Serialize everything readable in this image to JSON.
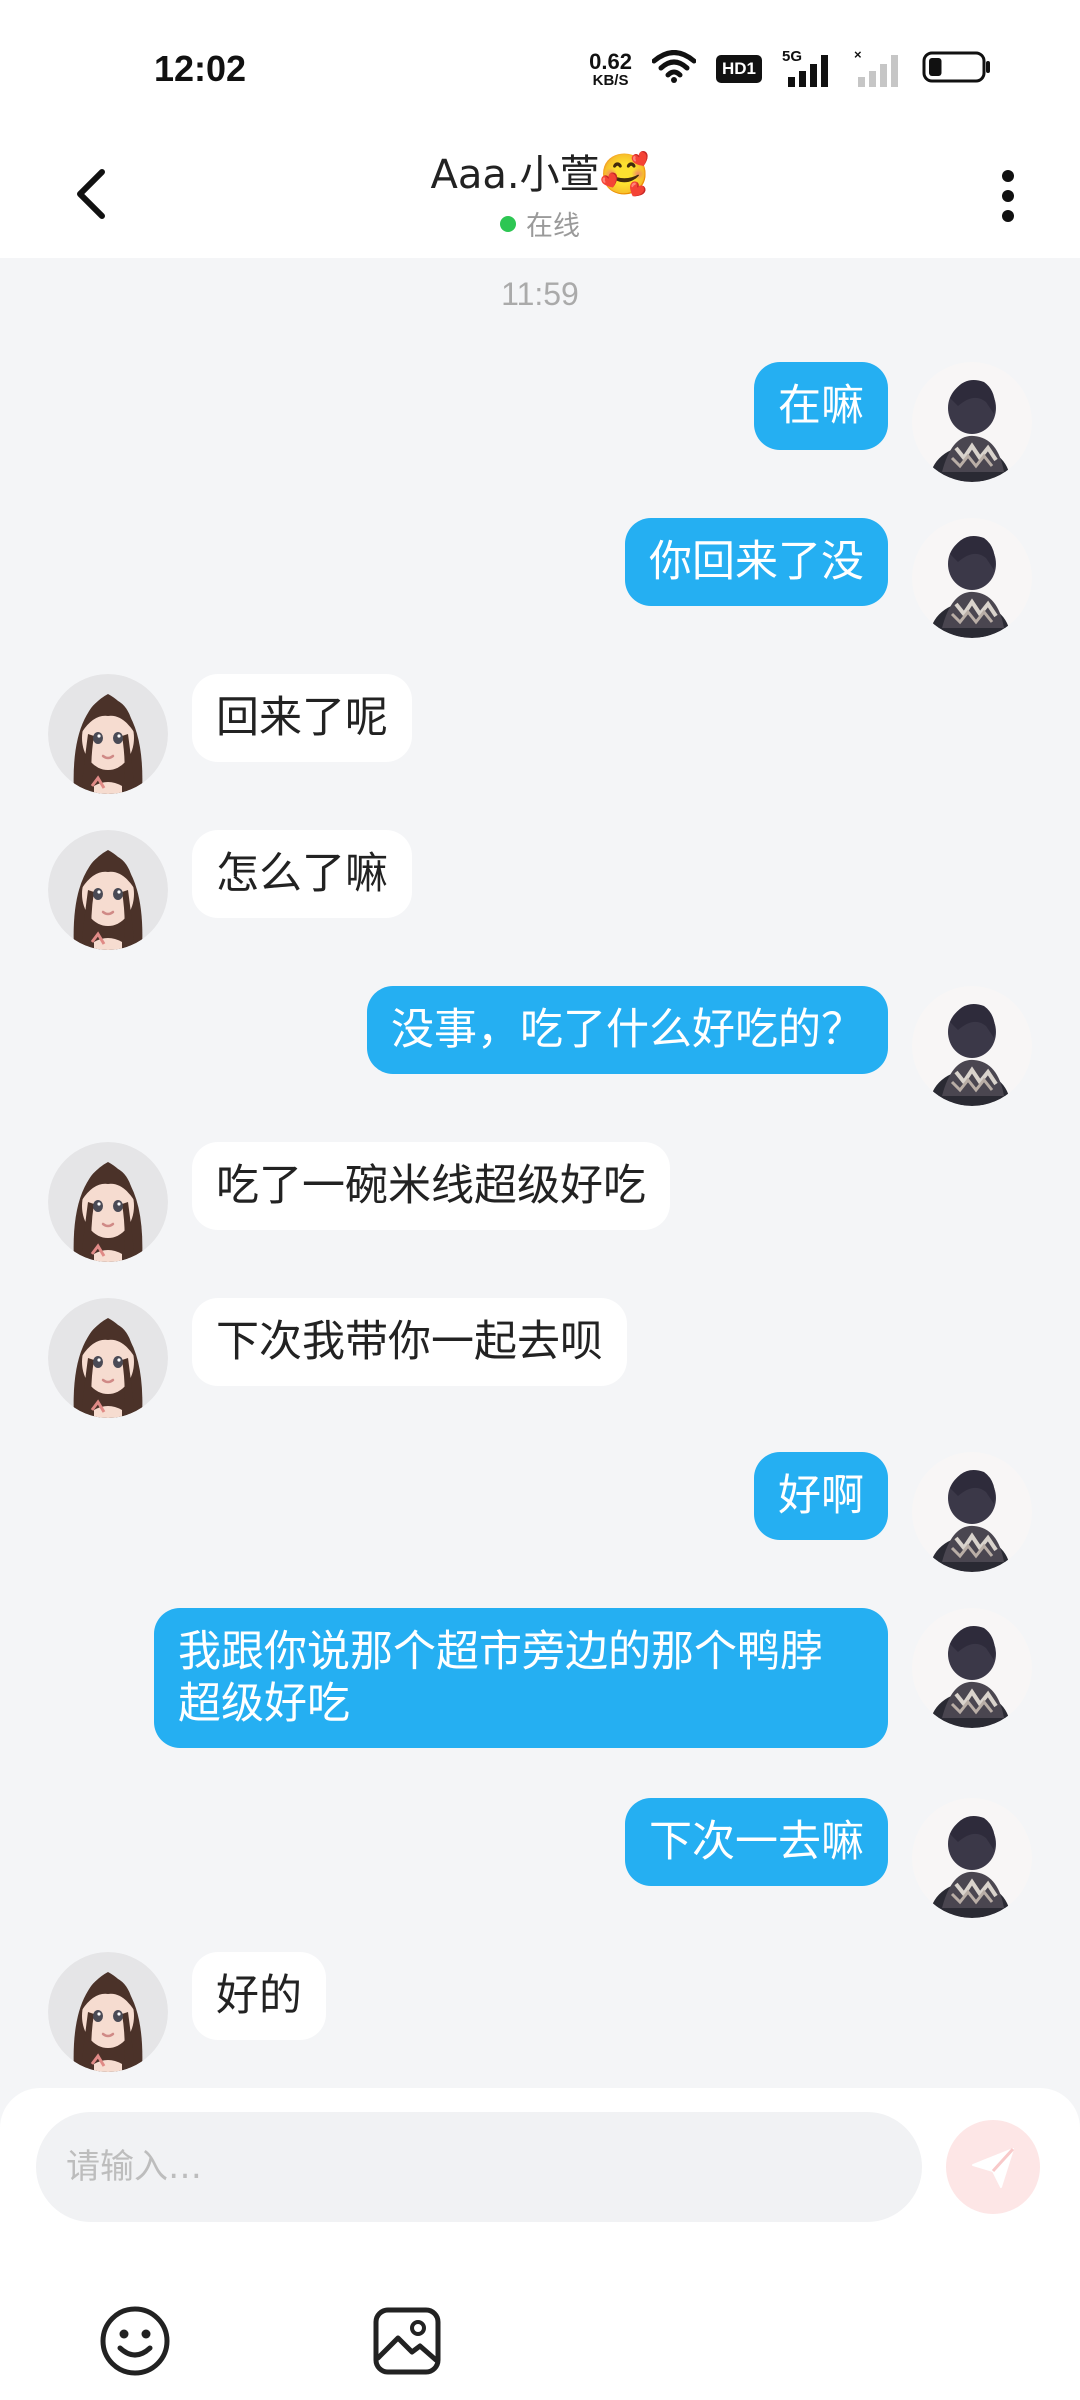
{
  "status_bar": {
    "time": "12:02",
    "net_speed_value": "0.62",
    "net_speed_unit": "KB/S",
    "hd_badge": "HD1",
    "signal_label": "5G",
    "battery_level": 0.25
  },
  "header": {
    "title": "Aaa.小萱🥰",
    "status": "在线",
    "status_color": "#2dc653"
  },
  "conversation": {
    "timestamp": "11:59",
    "messages": [
      {
        "from": "me",
        "text": "在嘛"
      },
      {
        "from": "me",
        "text": "你回来了没"
      },
      {
        "from": "her",
        "text": "回来了呢"
      },
      {
        "from": "her",
        "text": "怎么了嘛"
      },
      {
        "from": "me",
        "text": "没事，吃了什么好吃的？"
      },
      {
        "from": "her",
        "text": "吃了一碗米线超级好吃"
      },
      {
        "from": "her",
        "text": "下次我带你一起去呗"
      },
      {
        "from": "me",
        "text": "好啊"
      },
      {
        "from": "me",
        "text": "我跟你说那个超市旁边的那个鸭脖超级好吃"
      },
      {
        "from": "me",
        "text": "下次一去嘛"
      },
      {
        "from": "her",
        "text": "好的"
      }
    ]
  },
  "composer": {
    "placeholder": "请输入…",
    "icons": [
      "emoji-icon",
      "image-icon",
      "send-icon"
    ]
  },
  "colors": {
    "my_bubble": "#25aff2",
    "her_bubble": "#ffffff",
    "background": "#f4f5f7",
    "send_button": "#fde6e6"
  }
}
